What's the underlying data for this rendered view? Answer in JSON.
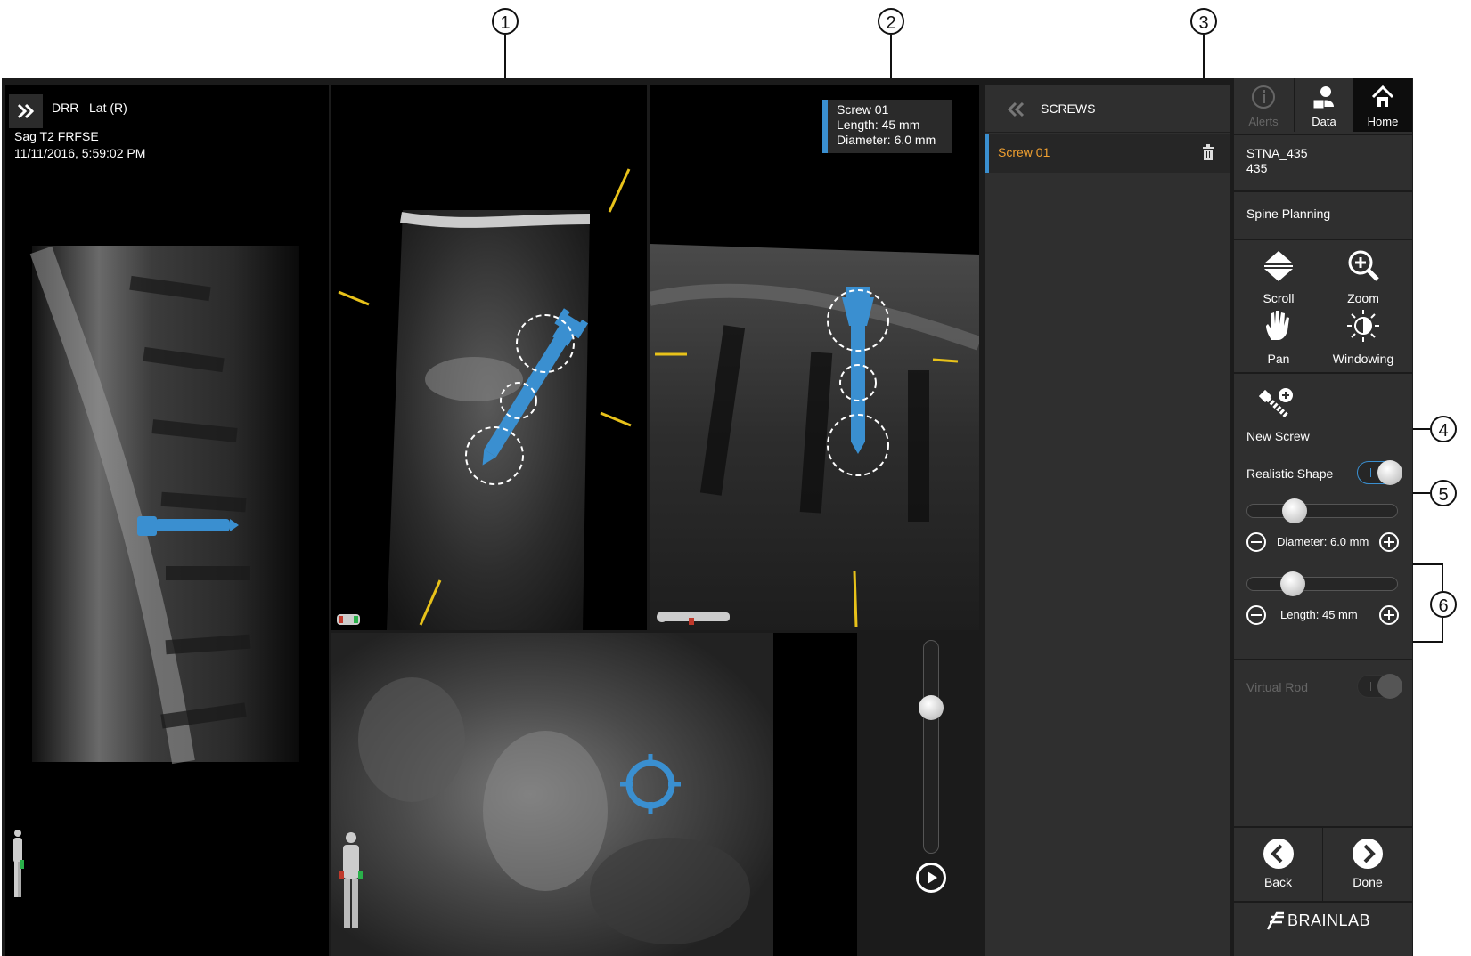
{
  "callouts": [
    "1",
    "2",
    "3",
    "4",
    "5",
    "6"
  ],
  "viewer": {
    "left_panel": {
      "mode": "DRR",
      "orientation": "Lat (R)",
      "series": "Sag T2 FRFSE",
      "datetime": "11/11/2016, 5:59:02 PM"
    },
    "screw_tooltip": {
      "name": "Screw 01",
      "length": "Length: 45 mm",
      "diameter": "Diameter: 6.0 mm"
    }
  },
  "screws_panel": {
    "title": "SCREWS",
    "items": [
      {
        "label": "Screw 01"
      }
    ]
  },
  "sidebar": {
    "tabs": [
      {
        "label": "Alerts",
        "icon": "info-icon",
        "enabled": false
      },
      {
        "label": "Data",
        "icon": "patient-data-icon",
        "enabled": true
      },
      {
        "label": "Home",
        "icon": "home-icon",
        "enabled": true,
        "active": true
      }
    ],
    "patient": {
      "name": "STNA_435",
      "id": "435"
    },
    "workflow": "Spine Planning",
    "tools": [
      {
        "label": "Scroll",
        "icon": "scroll-icon"
      },
      {
        "label": "Zoom",
        "icon": "zoom-in-icon"
      },
      {
        "label": "Pan",
        "icon": "hand-icon"
      },
      {
        "label": "Windowing",
        "icon": "windowing-icon"
      }
    ],
    "new_screw": "New Screw",
    "realistic_shape": {
      "label": "Realistic Shape",
      "on": true
    },
    "diameter": {
      "label": "Diameter: 6.0 mm",
      "value_mm": 6.0,
      "level": 0.28
    },
    "length": {
      "label": "Length: 45 mm",
      "value_mm": 45,
      "level": 0.27
    },
    "virtual_rod": {
      "label": "Virtual Rod",
      "on": false,
      "enabled": false
    },
    "back": "Back",
    "done": "Done",
    "brand": "BRAINLAB"
  },
  "colors": {
    "accent_blue": "#3a8fd0",
    "screw_label": "#f0a030",
    "trajectory_yellow": "#e8c21a",
    "panel_bg": "#2f2f2f"
  }
}
